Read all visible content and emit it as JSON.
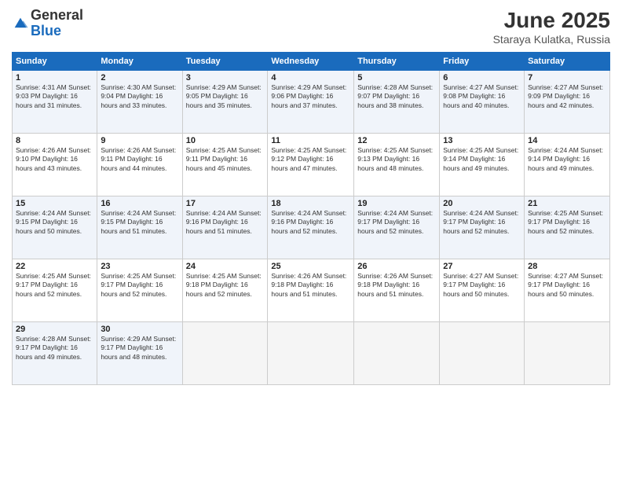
{
  "logo": {
    "general": "General",
    "blue": "Blue"
  },
  "title": "June 2025",
  "subtitle": "Staraya Kulatka, Russia",
  "days_of_week": [
    "Sunday",
    "Monday",
    "Tuesday",
    "Wednesday",
    "Thursday",
    "Friday",
    "Saturday"
  ],
  "weeks": [
    [
      {
        "day": "1",
        "info": "Sunrise: 4:31 AM\nSunset: 9:03 PM\nDaylight: 16 hours\nand 31 minutes."
      },
      {
        "day": "2",
        "info": "Sunrise: 4:30 AM\nSunset: 9:04 PM\nDaylight: 16 hours\nand 33 minutes."
      },
      {
        "day": "3",
        "info": "Sunrise: 4:29 AM\nSunset: 9:05 PM\nDaylight: 16 hours\nand 35 minutes."
      },
      {
        "day": "4",
        "info": "Sunrise: 4:29 AM\nSunset: 9:06 PM\nDaylight: 16 hours\nand 37 minutes."
      },
      {
        "day": "5",
        "info": "Sunrise: 4:28 AM\nSunset: 9:07 PM\nDaylight: 16 hours\nand 38 minutes."
      },
      {
        "day": "6",
        "info": "Sunrise: 4:27 AM\nSunset: 9:08 PM\nDaylight: 16 hours\nand 40 minutes."
      },
      {
        "day": "7",
        "info": "Sunrise: 4:27 AM\nSunset: 9:09 PM\nDaylight: 16 hours\nand 42 minutes."
      }
    ],
    [
      {
        "day": "8",
        "info": "Sunrise: 4:26 AM\nSunset: 9:10 PM\nDaylight: 16 hours\nand 43 minutes."
      },
      {
        "day": "9",
        "info": "Sunrise: 4:26 AM\nSunset: 9:11 PM\nDaylight: 16 hours\nand 44 minutes."
      },
      {
        "day": "10",
        "info": "Sunrise: 4:25 AM\nSunset: 9:11 PM\nDaylight: 16 hours\nand 45 minutes."
      },
      {
        "day": "11",
        "info": "Sunrise: 4:25 AM\nSunset: 9:12 PM\nDaylight: 16 hours\nand 47 minutes."
      },
      {
        "day": "12",
        "info": "Sunrise: 4:25 AM\nSunset: 9:13 PM\nDaylight: 16 hours\nand 48 minutes."
      },
      {
        "day": "13",
        "info": "Sunrise: 4:25 AM\nSunset: 9:14 PM\nDaylight: 16 hours\nand 49 minutes."
      },
      {
        "day": "14",
        "info": "Sunrise: 4:24 AM\nSunset: 9:14 PM\nDaylight: 16 hours\nand 49 minutes."
      }
    ],
    [
      {
        "day": "15",
        "info": "Sunrise: 4:24 AM\nSunset: 9:15 PM\nDaylight: 16 hours\nand 50 minutes."
      },
      {
        "day": "16",
        "info": "Sunrise: 4:24 AM\nSunset: 9:15 PM\nDaylight: 16 hours\nand 51 minutes."
      },
      {
        "day": "17",
        "info": "Sunrise: 4:24 AM\nSunset: 9:16 PM\nDaylight: 16 hours\nand 51 minutes."
      },
      {
        "day": "18",
        "info": "Sunrise: 4:24 AM\nSunset: 9:16 PM\nDaylight: 16 hours\nand 52 minutes."
      },
      {
        "day": "19",
        "info": "Sunrise: 4:24 AM\nSunset: 9:17 PM\nDaylight: 16 hours\nand 52 minutes."
      },
      {
        "day": "20",
        "info": "Sunrise: 4:24 AM\nSunset: 9:17 PM\nDaylight: 16 hours\nand 52 minutes."
      },
      {
        "day": "21",
        "info": "Sunrise: 4:25 AM\nSunset: 9:17 PM\nDaylight: 16 hours\nand 52 minutes."
      }
    ],
    [
      {
        "day": "22",
        "info": "Sunrise: 4:25 AM\nSunset: 9:17 PM\nDaylight: 16 hours\nand 52 minutes."
      },
      {
        "day": "23",
        "info": "Sunrise: 4:25 AM\nSunset: 9:17 PM\nDaylight: 16 hours\nand 52 minutes."
      },
      {
        "day": "24",
        "info": "Sunrise: 4:25 AM\nSunset: 9:18 PM\nDaylight: 16 hours\nand 52 minutes."
      },
      {
        "day": "25",
        "info": "Sunrise: 4:26 AM\nSunset: 9:18 PM\nDaylight: 16 hours\nand 51 minutes."
      },
      {
        "day": "26",
        "info": "Sunrise: 4:26 AM\nSunset: 9:18 PM\nDaylight: 16 hours\nand 51 minutes."
      },
      {
        "day": "27",
        "info": "Sunrise: 4:27 AM\nSunset: 9:17 PM\nDaylight: 16 hours\nand 50 minutes."
      },
      {
        "day": "28",
        "info": "Sunrise: 4:27 AM\nSunset: 9:17 PM\nDaylight: 16 hours\nand 50 minutes."
      }
    ],
    [
      {
        "day": "29",
        "info": "Sunrise: 4:28 AM\nSunset: 9:17 PM\nDaylight: 16 hours\nand 49 minutes."
      },
      {
        "day": "30",
        "info": "Sunrise: 4:29 AM\nSunset: 9:17 PM\nDaylight: 16 hours\nand 48 minutes."
      },
      null,
      null,
      null,
      null,
      null
    ]
  ]
}
